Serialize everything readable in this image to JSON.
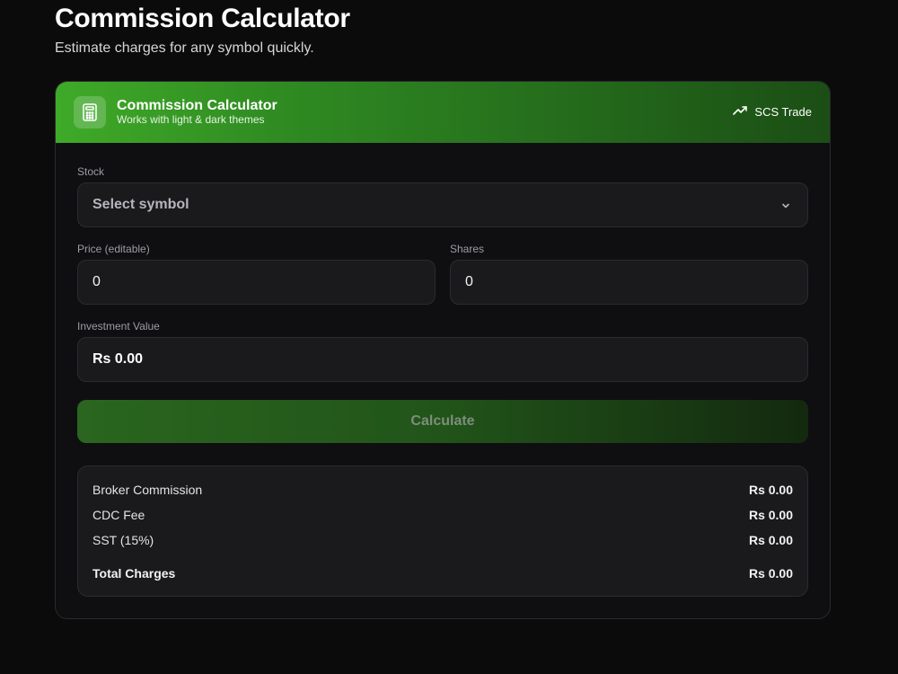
{
  "page": {
    "title": "Commission Calculator",
    "subtitle": "Estimate charges for any symbol quickly."
  },
  "card": {
    "header": {
      "title": "Commission Calculator",
      "subtitle": "Works with light & dark themes",
      "brand_label": "SCS Trade",
      "icon": "calculator-icon",
      "brand_icon": "trending-up-icon",
      "gradient_colors": [
        "#3faa28",
        "#1b4e15"
      ]
    },
    "form": {
      "stock_label": "Stock",
      "stock_placeholder": "Select symbol",
      "price_label": "Price (editable)",
      "price_value": "0",
      "shares_label": "Shares",
      "shares_value": "0",
      "investment_label": "Investment Value",
      "investment_value": "Rs 0.00",
      "calculate_label": "Calculate"
    },
    "results": [
      {
        "label": "Broker Commission",
        "value": "Rs 0.00"
      },
      {
        "label": "CDC Fee",
        "value": "Rs 0.00"
      },
      {
        "label": "SST (15%)",
        "value": "Rs 0.00"
      },
      {
        "label": "Total Charges",
        "value": "Rs 0.00"
      }
    ]
  }
}
